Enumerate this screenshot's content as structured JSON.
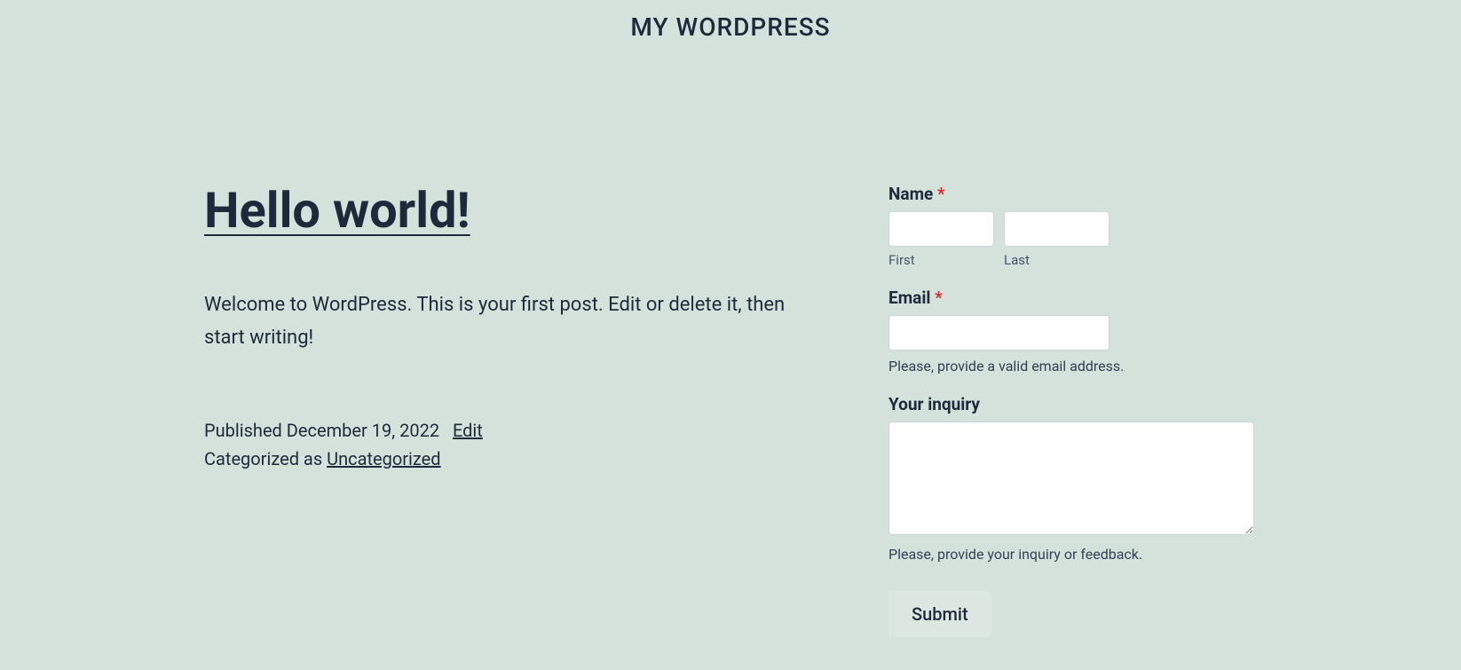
{
  "header": {
    "site_title": "MY WORDPRESS"
  },
  "post": {
    "title": "Hello world!",
    "content": "Welcome to WordPress. This is your first post. Edit or delete it, then start writing!",
    "published_label": "Published ",
    "published_date": "December 19, 2022",
    "edit_label": "Edit",
    "categorized_label": "Categorized as ",
    "category": "Uncategorized"
  },
  "form": {
    "name": {
      "label": "Name ",
      "required_star": "*",
      "first_sub": "First",
      "last_sub": "Last"
    },
    "email": {
      "label": "Email ",
      "required_star": "*",
      "help": "Please, provide a valid email address."
    },
    "inquiry": {
      "label": "Your inquiry",
      "help": "Please, provide your inquiry or feedback."
    },
    "submit_label": "Submit"
  }
}
